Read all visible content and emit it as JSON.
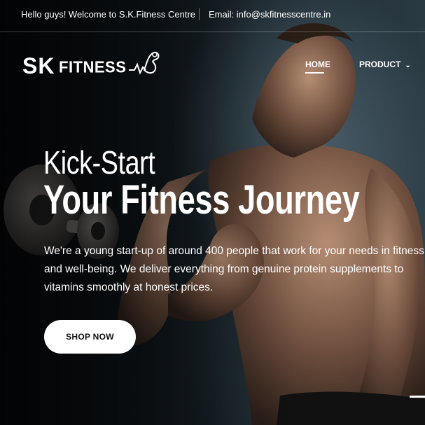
{
  "topbar": {
    "welcome": "Hello guys! Welcome to S.K.Fitness Centre",
    "email": "Email: info@skfitnesscentre.in"
  },
  "logo": {
    "sk": "SK",
    "fitness": "FITNESS"
  },
  "nav": {
    "items": [
      {
        "label": "HOME",
        "active": true
      },
      {
        "label": "PRODUCT",
        "has_dropdown": true
      }
    ]
  },
  "hero": {
    "title_line1": "Kick-Start",
    "title_line2": "Your Fitness Journey",
    "description_lines": [
      "We're a young start-up of around 400 people that work for your needs in fitness",
      "and well-being. We deliver everything from genuine protein supplements to",
      "vitamins smoothly at honest prices."
    ],
    "cta_label": "SHOP NOW"
  },
  "colors": {
    "accent": "#ffffff",
    "background": "#0c0f12",
    "button_text": "#111111"
  }
}
